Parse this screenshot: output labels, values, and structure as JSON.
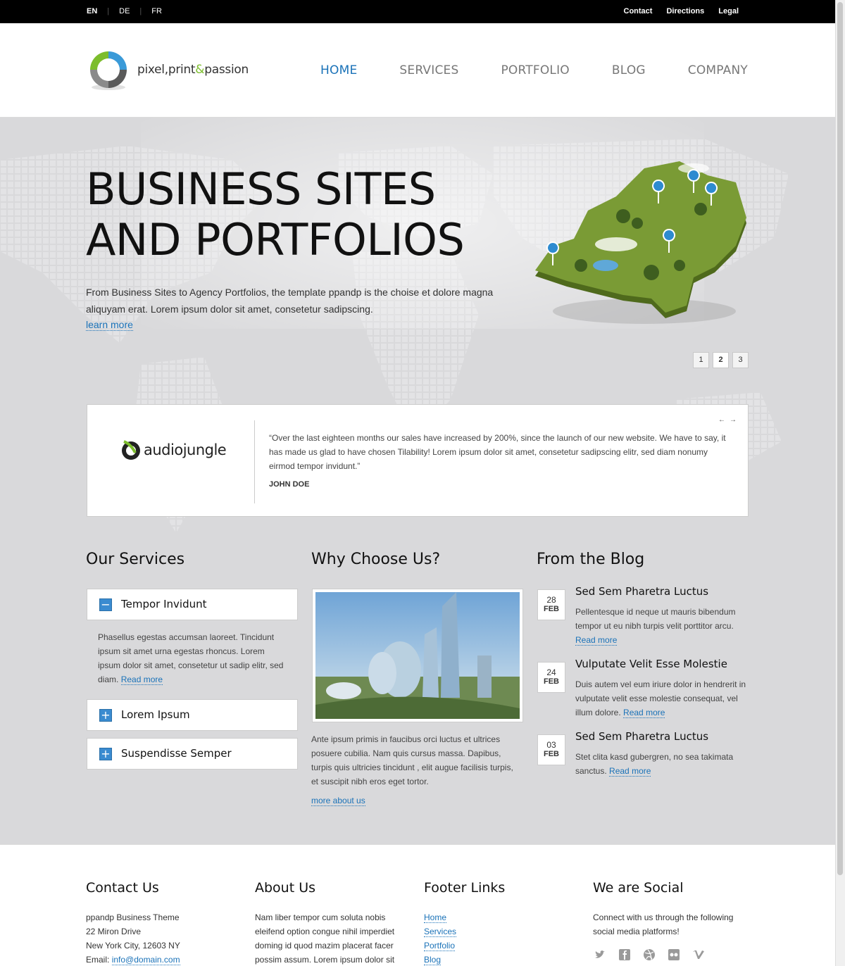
{
  "topbar": {
    "languages": [
      "EN",
      "DE",
      "FR"
    ],
    "active_language": "EN",
    "links": [
      "Contact",
      "Directions",
      "Legal"
    ]
  },
  "header": {
    "logo_text_1": "pixel,print",
    "logo_amp": "&",
    "logo_text_2": "passion",
    "nav": [
      "HOME",
      "SERVICES",
      "PORTFOLIO",
      "BLOG",
      "COMPANY"
    ],
    "active_nav": "HOME"
  },
  "hero": {
    "title_line1": "BUSINESS SITES",
    "title_line2": "AND PORTFOLIOS",
    "text": "From Business Sites to Agency Portfolios, the template ppandp is the choise et dolore magna aliquyam erat. Lorem ipsum dolor sit amet, consetetur sadipscing.",
    "link": "learn more",
    "pages": [
      "1",
      "2",
      "3"
    ],
    "active_page": "2"
  },
  "testimonial": {
    "logo_text": "audiojungle",
    "quote": "“Over the last eighteen months our sales have increased by 200%, since the launch of our new website. We have to say, it has made us glad to have chosen Tilability! Lorem ipsum dolor sit amet, consetetur sadipscing elitr, sed diam nonumy eirmod tempor invidunt.”",
    "author": "JOHN DOE",
    "prev": "←",
    "next": "→"
  },
  "services": {
    "title": "Our Services",
    "items": [
      {
        "label": "Tempor Invidunt",
        "icon": "−",
        "expanded": true
      },
      {
        "label": "Lorem Ipsum",
        "icon": "+",
        "expanded": false
      },
      {
        "label": "Suspendisse Semper",
        "icon": "+",
        "expanded": false
      }
    ],
    "body": "Phasellus egestas accumsan laoreet. Tincidunt ipsum sit amet urna egestas rhoncus. Lorem ipsum dolor sit amet, consetetur ut sadip elitr, sed diam.",
    "read_more": "Read more"
  },
  "why": {
    "title": "Why Choose Us?",
    "text": "Ante ipsum primis in faucibus orci luctus et ultrices posuere cubilia. Nam quis cursus massa. Dapibus, turpis quis ultricies tincidunt , elit augue facilisis turpis, et suscipit nibh eros eget tortor.",
    "link": "more about us"
  },
  "blog": {
    "title": "From the Blog",
    "posts": [
      {
        "day": "28",
        "month": "FEB",
        "title": "Sed Sem Pharetra Luctus",
        "text": "Pellentesque id neque ut mauris bibendum tempor ut eu nibh turpis velit porttitor arcu.",
        "more": "Read more"
      },
      {
        "day": "24",
        "month": "FEB",
        "title": "Vulputate Velit Esse Molestie",
        "text": "Duis autem vel eum iriure dolor in hendrerit in vulputate velit esse molestie consequat, vel illum dolore.",
        "more": "Read more"
      },
      {
        "day": "03",
        "month": "FEB",
        "title": "Sed Sem Pharetra Luctus",
        "text": "Stet clita kasd gubergren, no sea takimata sanctus.",
        "more": "Read more"
      }
    ]
  },
  "footer": {
    "contact": {
      "title": "Contact Us",
      "line1": "ppandp Business Theme",
      "line2": "22 Miron Drive",
      "line3": "New York City, 12603 NY",
      "email_label": "Email: ",
      "email": "info@domain.com"
    },
    "about": {
      "title": "About Us",
      "text": "Nam liber tempor cum soluta nobis eleifend option congue nihil imperdiet doming id quod mazim placerat facer possim assum. Lorem ipsum dolor sit"
    },
    "links": {
      "title": "Footer Links",
      "items": [
        "Home",
        "Services",
        "Portfolio",
        "Blog"
      ]
    },
    "social": {
      "title": "We are Social",
      "text": "Connect with us through the following social media platforms!",
      "icons": [
        "twitter-icon",
        "facebook-icon",
        "dribbble-icon",
        "flickr-icon",
        "vimeo-icon"
      ]
    }
  },
  "colors": {
    "accent": "#1a72b8",
    "brand_green": "#7cbd2c",
    "main_bg": "#d9d9db"
  }
}
